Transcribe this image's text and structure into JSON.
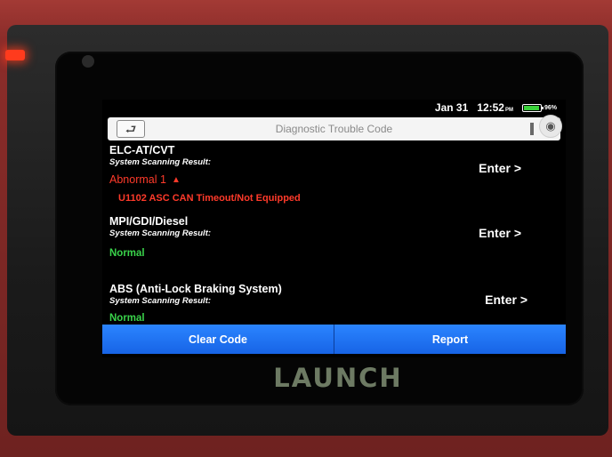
{
  "device": {
    "brand_logo": "LAUNCH",
    "led_color": "#ff3b1d"
  },
  "status_bar": {
    "date": "Jan 31",
    "time": "12:52",
    "time_suffix": "PM",
    "battery_percent": "96%",
    "battery_level": 0.96
  },
  "header": {
    "title": "Diagnostic Trouble Code",
    "back_icon": "back-arrow-icon",
    "screenshot_icon": "camera-icon"
  },
  "systems": [
    {
      "name": "ELC-AT/CVT",
      "scan_label": "System Scanning Result:",
      "status": "Abnormal 1",
      "status_color": "#ff3a2a",
      "expand_icon": "triangle-up-icon",
      "dtc": "U1102 ASC CAN Timeout/Not Equipped",
      "enter_label": "Enter >"
    },
    {
      "name": "MPI/GDI/Diesel",
      "scan_label": "System Scanning Result:",
      "status": "Normal",
      "status_color": "#39d24a",
      "enter_label": "Enter >"
    },
    {
      "name": "ABS (Anti-Lock Braking System)",
      "scan_label": "System Scanning Result:",
      "status": "Normal",
      "status_color": "#39d24a",
      "enter_label": "Enter >"
    }
  ],
  "actions": {
    "clear_code": "Clear Code",
    "report": "Report"
  },
  "colors": {
    "accent_blue": "#1e6ff2",
    "error_red": "#ff3a2a",
    "ok_green": "#39d24a"
  }
}
